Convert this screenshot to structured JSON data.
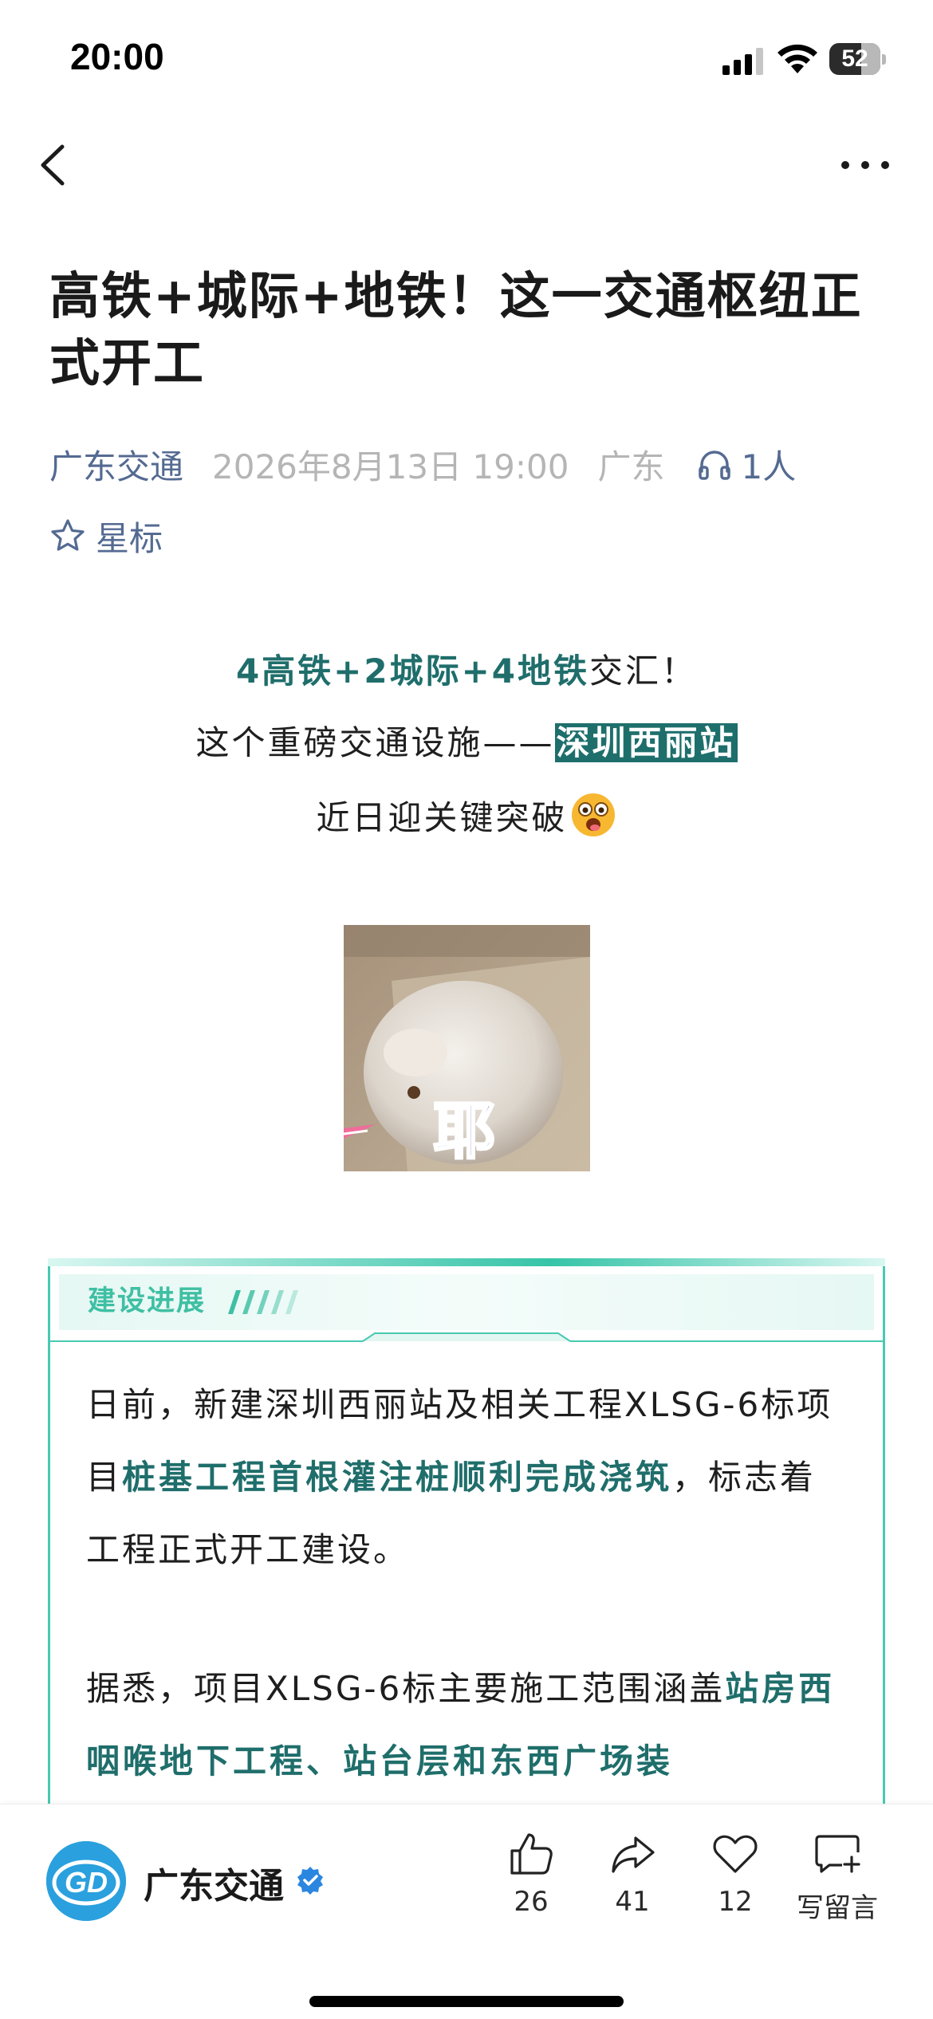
{
  "status_bar": {
    "time": "20:00",
    "battery_level": "52",
    "icons": [
      "signal-icon",
      "wifi-icon",
      "battery-icon"
    ]
  },
  "nav": {
    "icons": [
      "back-chevron-icon",
      "more-dots-icon"
    ]
  },
  "article": {
    "title": "高铁+城际+地铁！这一交通枢纽正式开工",
    "author": "广东交通",
    "date": "2026年8月13日 19:00",
    "location": "广东",
    "listeners": "1人",
    "star_label": "星标"
  },
  "intro": {
    "line1_highlight": "4高铁+2城际+4地铁",
    "line1_rest": "交汇！",
    "line2_prefix": "这个重磅交通设施——",
    "line2_highlight": "深圳西丽站",
    "line3": "近日迎关键突破",
    "emoji": "astonished-face-icon"
  },
  "image": {
    "caption": "耶"
  },
  "section": {
    "title": "建设进展",
    "para1_a": "日前，新建深圳西丽站及相关工程XLSG-6标项目",
    "para1_b": "桩基工程首根灌注桩顺利完成浇筑",
    "para1_c": "，标志着工程正式开工建设。",
    "para2_a": "据悉，项目XLSG-6标主要施工范围涵盖",
    "para2_b": "站房西咽喉地下工程、站台层和东西广场装"
  },
  "bottom_bar": {
    "account_name": "广东交通",
    "logo_text": "GD",
    "like_count": "26",
    "share_count": "41",
    "favorite_count": "12",
    "comment_label": "写留言"
  },
  "colors": {
    "accent_teal": "#1e6f6c",
    "section_green": "#3fbfa3",
    "meta_blue": "#546a92",
    "brand_blue": "#2aa0de"
  }
}
